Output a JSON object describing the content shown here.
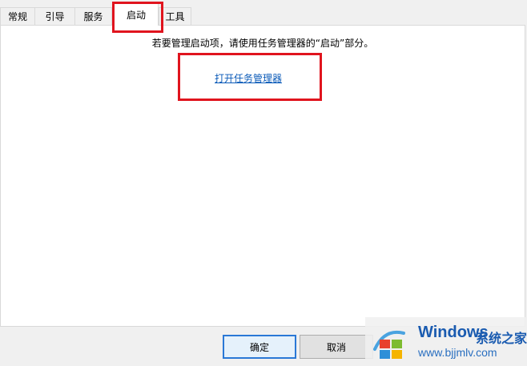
{
  "tabs": [
    {
      "label": "常规"
    },
    {
      "label": "引导"
    },
    {
      "label": "服务"
    },
    {
      "label": "启动",
      "active": true
    },
    {
      "label": "工具"
    }
  ],
  "startup": {
    "hint": "若要管理启动项，请使用任务管理器的“启动”部分。",
    "open_link": "打开任务管理器"
  },
  "buttons": {
    "ok": "确定",
    "cancel": "取消"
  },
  "watermark": {
    "brand": "Windows",
    "brand_cn": "系统之家",
    "url": "www.bjjmlv.com"
  },
  "colors": {
    "highlight": "#e0141e",
    "link": "#0a5ab8"
  }
}
